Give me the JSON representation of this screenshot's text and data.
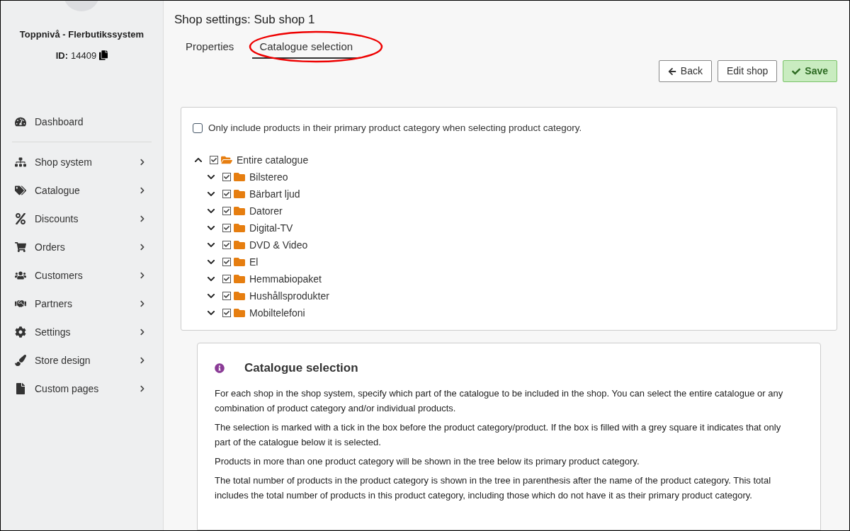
{
  "sidebar": {
    "shop_name": "Toppnivå - Flerbutikssystem",
    "id_label": "ID:",
    "id_value": "14409",
    "top_items": [
      {
        "label": "Dashboard"
      }
    ],
    "items": [
      {
        "label": "Shop system"
      },
      {
        "label": "Catalogue"
      },
      {
        "label": "Discounts"
      },
      {
        "label": "Orders"
      },
      {
        "label": "Customers"
      },
      {
        "label": "Partners"
      },
      {
        "label": "Settings"
      },
      {
        "label": "Store design"
      },
      {
        "label": "Custom pages"
      }
    ]
  },
  "page": {
    "title": "Shop settings: Sub shop 1",
    "tabs": [
      {
        "label": "Properties",
        "selected": false,
        "highlighted": false
      },
      {
        "label": "Catalogue selection",
        "selected": true,
        "highlighted": true
      }
    ],
    "buttons": [
      {
        "label": "Back",
        "kind": "back"
      },
      {
        "label": "Edit shop",
        "kind": "plain"
      },
      {
        "label": "Save",
        "kind": "save"
      }
    ]
  },
  "tree_card": {
    "option": {
      "label": "Only include products in their primary product category when selecting product category.",
      "checked": false
    },
    "tree": [
      {
        "label": "Entire catalogue",
        "checked": true,
        "expanded": true,
        "children": [
          {
            "label": "Bilstereo",
            "checked": true,
            "expanded": false
          },
          {
            "label": "Bärbart ljud",
            "checked": true,
            "expanded": false
          },
          {
            "label": "Datorer",
            "checked": true,
            "expanded": false
          },
          {
            "label": "Digital-TV",
            "checked": true,
            "expanded": false
          },
          {
            "label": "DVD & Video",
            "checked": true,
            "expanded": false
          },
          {
            "label": "El",
            "checked": true,
            "expanded": false
          },
          {
            "label": "Hemmabiopaket",
            "checked": true,
            "expanded": false
          },
          {
            "label": "Hushållsprodukter",
            "checked": true,
            "expanded": false
          },
          {
            "label": "Mobiltelefoni",
            "checked": true,
            "expanded": false
          }
        ]
      }
    ]
  },
  "info": {
    "title": "Catalogue selection",
    "paragraphs": [
      "For each shop in the shop system, specify which part of the catalogue to be included in the shop. You can select the entire catalogue or any combination of product category and/or individual products.",
      "The selection is marked with a tick in the box before the product category/product. If the box is filled with a grey square it indicates that only part of the catalogue below it is selected.",
      "Products in more than one product category will be shown in the tree below its primary product category.",
      "The total number of products in the product category is shown in the tree in parenthesis after the name of the product category. This total includes the total number of products in this product category, including those which do not have it as their primary product category."
    ]
  }
}
